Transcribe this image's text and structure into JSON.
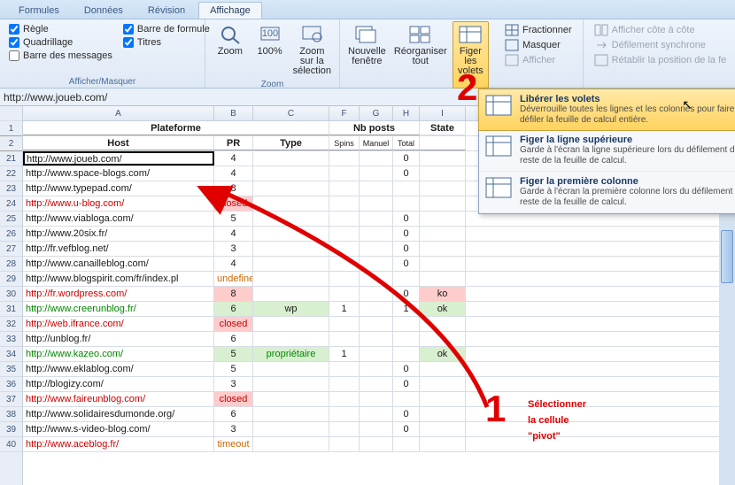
{
  "tabs": [
    "Formules",
    "Données",
    "Révision",
    "Affichage"
  ],
  "active_tab": 3,
  "ribbon": {
    "show_hide": {
      "title": "Afficher/Masquer",
      "items": [
        {
          "label": "Règle",
          "checked": true
        },
        {
          "label": "Quadrillage",
          "checked": true
        },
        {
          "label": "Barre des messages",
          "checked": false
        },
        {
          "label": "Barre de formule",
          "checked": true
        },
        {
          "label": "Titres",
          "checked": true
        }
      ]
    },
    "zoom": {
      "title": "Zoom",
      "btn_zoom": "Zoom",
      "btn_100": "100%",
      "btn_sel": "Zoom sur la sélection"
    },
    "window": {
      "btn_new": "Nouvelle fenêtre",
      "btn_arrange": "Réorganiser tout",
      "btn_freeze": "Figer les volets ▾"
    },
    "winopts": [
      {
        "label": "Fractionner"
      },
      {
        "label": "Masquer"
      },
      {
        "label": "Afficher"
      }
    ],
    "winopts2": [
      {
        "label": "Afficher côte à côte"
      },
      {
        "label": "Défilement synchrone"
      },
      {
        "label": "Rétablir la position de la fe"
      }
    ]
  },
  "formula_bar": "http://www.joueb.com/",
  "columns": [
    "A",
    "B",
    "C",
    "F",
    "G",
    "H",
    "I"
  ],
  "merged_headers": {
    "plateforme": "Plateforme",
    "nb": "Nb posts",
    "state": "State"
  },
  "sub_headers": {
    "host": "Host",
    "pr": "PR",
    "type": "Type",
    "spins": "Spins",
    "manuel": "Manuel",
    "total": "Total"
  },
  "row_numbers": [
    "1",
    "2",
    "21",
    "22",
    "23",
    "24",
    "25",
    "26",
    "27",
    "28",
    "29",
    "30",
    "31",
    "32",
    "33",
    "34",
    "35",
    "36",
    "37",
    "38",
    "39",
    "40"
  ],
  "rows": [
    {
      "host": "http://www.joueb.com/",
      "pr": "4",
      "type": "",
      "f": "",
      "g": "",
      "h": "0",
      "state": "",
      "cls": "sel"
    },
    {
      "host": "http://www.space-blogs.com/",
      "pr": "4",
      "type": "",
      "f": "",
      "g": "",
      "h": "0",
      "state": ""
    },
    {
      "host": "http://www.typepad.com/",
      "pr": "8",
      "type": "",
      "f": "",
      "g": "",
      "h": "",
      "state": ""
    },
    {
      "host": "http://www.u-blog.com/",
      "pr": "closed",
      "type": "",
      "f": "",
      "g": "",
      "h": "",
      "state": "",
      "hostcls": "red",
      "prcls": "red redbg"
    },
    {
      "host": "http://www.viabloga.com/",
      "pr": "5",
      "type": "",
      "f": "",
      "g": "",
      "h": "0",
      "state": ""
    },
    {
      "host": "http://www.20six.fr/",
      "pr": "4",
      "type": "",
      "f": "",
      "g": "",
      "h": "0",
      "state": ""
    },
    {
      "host": "http://fr.vefblog.net/",
      "pr": "3",
      "type": "",
      "f": "",
      "g": "",
      "h": "0",
      "state": ""
    },
    {
      "host": "http://www.canailleblog.com/",
      "pr": "4",
      "type": "",
      "f": "",
      "g": "",
      "h": "0",
      "state": ""
    },
    {
      "host": "http://www.blogspirit.com/fr/index.pl",
      "pr": "undefined",
      "type": "",
      "f": "",
      "g": "",
      "h": "",
      "state": "",
      "prcls": "orng"
    },
    {
      "host": "http://fr.wordpress.com/",
      "pr": "8",
      "type": "",
      "f": "",
      "g": "",
      "h": "0",
      "state": "ko",
      "hostcls": "red",
      "prbg": "redbg",
      "stcls": "redbg"
    },
    {
      "host": "http://www.creerunblog.fr/",
      "pr": "6",
      "type": "wp",
      "f": "1",
      "g": "",
      "h": "1",
      "state": "ok",
      "hostcls": "grn",
      "prbg": "grnbg",
      "tbg": "grnbg",
      "stcls": "grnbg"
    },
    {
      "host": "http://web.ifrance.com/",
      "pr": "closed",
      "type": "",
      "f": "",
      "g": "",
      "h": "",
      "state": "",
      "hostcls": "red",
      "prcls": "red redbg"
    },
    {
      "host": "http://unblog.fr/",
      "pr": "6",
      "type": "",
      "f": "",
      "g": "",
      "h": "",
      "state": ""
    },
    {
      "host": "http://www.kazeo.com/",
      "pr": "5",
      "type": "propriétaire",
      "f": "1",
      "g": "",
      "h": "",
      "state": "ok",
      "hostcls": "grn",
      "prbg": "grnbg",
      "tbg": "grnbg",
      "tcls": "grn",
      "stcls": "grnbg"
    },
    {
      "host": "http://www.eklablog.com/",
      "pr": "5",
      "type": "",
      "f": "",
      "g": "",
      "h": "0",
      "state": ""
    },
    {
      "host": "http://blogizy.com/",
      "pr": "3",
      "type": "",
      "f": "",
      "g": "",
      "h": "0",
      "state": ""
    },
    {
      "host": "http://www.faireunblog.com/",
      "pr": "closed",
      "type": "",
      "f": "",
      "g": "",
      "h": "",
      "state": "",
      "hostcls": "red",
      "prcls": "red redbg"
    },
    {
      "host": "http://www.solidairesdumonde.org/",
      "pr": "6",
      "type": "",
      "f": "",
      "g": "",
      "h": "0",
      "state": ""
    },
    {
      "host": "http://www.s-video-blog.com/",
      "pr": "3",
      "type": "",
      "f": "",
      "g": "",
      "h": "0",
      "state": ""
    },
    {
      "host": "http://www.aceblog.fr/",
      "pr": "timeout",
      "type": "",
      "f": "",
      "g": "",
      "h": "",
      "state": "",
      "hostcls": "red",
      "prcls": "orng"
    }
  ],
  "dropdown": [
    {
      "title": "Libérer les volets",
      "desc": "Déverrouille toutes les lignes et les colonnes pour faire défiler la feuille de calcul entière.",
      "hover": true
    },
    {
      "title": "Figer la ligne supérieure",
      "desc": "Garde à l'écran la ligne supérieure lors du défilement du reste de la feuille de calcul."
    },
    {
      "title": "Figer la première colonne",
      "desc": "Garde à l'écran la première colonne lors du défilement du reste de la feuille de calcul."
    }
  ],
  "annotations": {
    "one": "1",
    "two": "2",
    "text1": "Sélectionner",
    "text2": "la cellule",
    "text3": "\"pivot\""
  }
}
